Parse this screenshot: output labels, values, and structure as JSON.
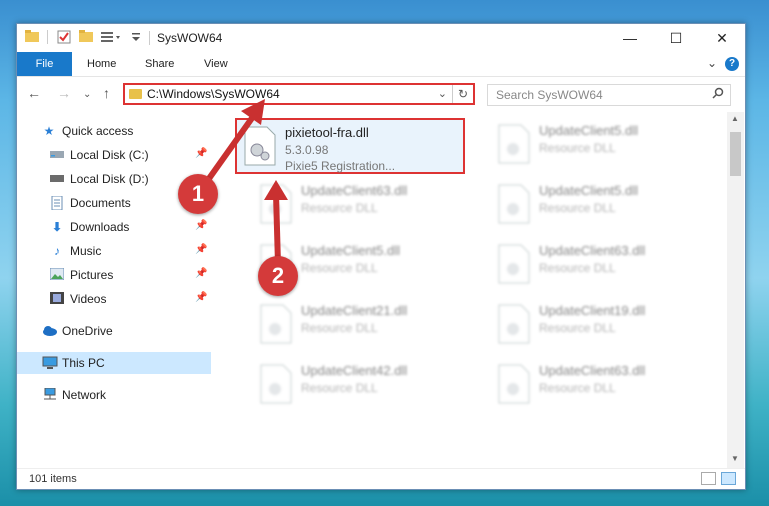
{
  "window": {
    "title": "SysWOW64",
    "controls": {
      "minimize": "—",
      "maximize": "☐",
      "close": "✕"
    }
  },
  "ribbon": {
    "file": "File",
    "tabs": [
      "Home",
      "Share",
      "View"
    ],
    "help": "?"
  },
  "address": {
    "path": "C:\\Windows\\SysWOW64",
    "search_placeholder": "Search SysWOW64"
  },
  "sidebar": {
    "items": [
      {
        "label": "Quick access",
        "icon": "star-icon"
      },
      {
        "label": "Local Disk (C:)",
        "icon": "drive-icon"
      },
      {
        "label": "Local Disk (D:)",
        "icon": "drive-icon"
      },
      {
        "label": "Documents",
        "icon": "documents-icon"
      },
      {
        "label": "Downloads",
        "icon": "download-icon"
      },
      {
        "label": "Music",
        "icon": "music-icon"
      },
      {
        "label": "Pictures",
        "icon": "pictures-icon"
      },
      {
        "label": "Videos",
        "icon": "videos-icon"
      },
      {
        "label": "OneDrive",
        "icon": "cloud-icon"
      },
      {
        "label": "This PC",
        "icon": "computer-icon"
      },
      {
        "label": "Network",
        "icon": "network-icon"
      }
    ]
  },
  "files": [
    {
      "name": "pixietool-fra.dll",
      "line2": "5.3.0.98",
      "line3": "Pixie5 Registration..."
    },
    {
      "name": "UpdateClient5.dll",
      "line2": "Resource DLL"
    },
    {
      "name": "UpdateClient63.dll",
      "line2": "Resource DLL"
    },
    {
      "name": "UpdateClient5.dll",
      "line2": "Resource DLL"
    },
    {
      "name": "UpdateClient5.dll",
      "line2": "Resource DLL"
    },
    {
      "name": "UpdateClient63.dll",
      "line2": "Resource DLL"
    },
    {
      "name": "UpdateClient21.dll",
      "line2": "Resource DLL"
    },
    {
      "name": "UpdateClient19.dll",
      "line2": "Resource DLL"
    },
    {
      "name": "UpdateClient42.dll",
      "line2": "Resource DLL"
    },
    {
      "name": "UpdateClient63.dll",
      "line2": "Resource DLL"
    }
  ],
  "status": {
    "items": "101 items"
  },
  "annotations": {
    "step1": "1",
    "step2": "2"
  },
  "colors": {
    "accent": "#1979ca",
    "highlight": "#d33333",
    "selected": "#cce8ff"
  }
}
